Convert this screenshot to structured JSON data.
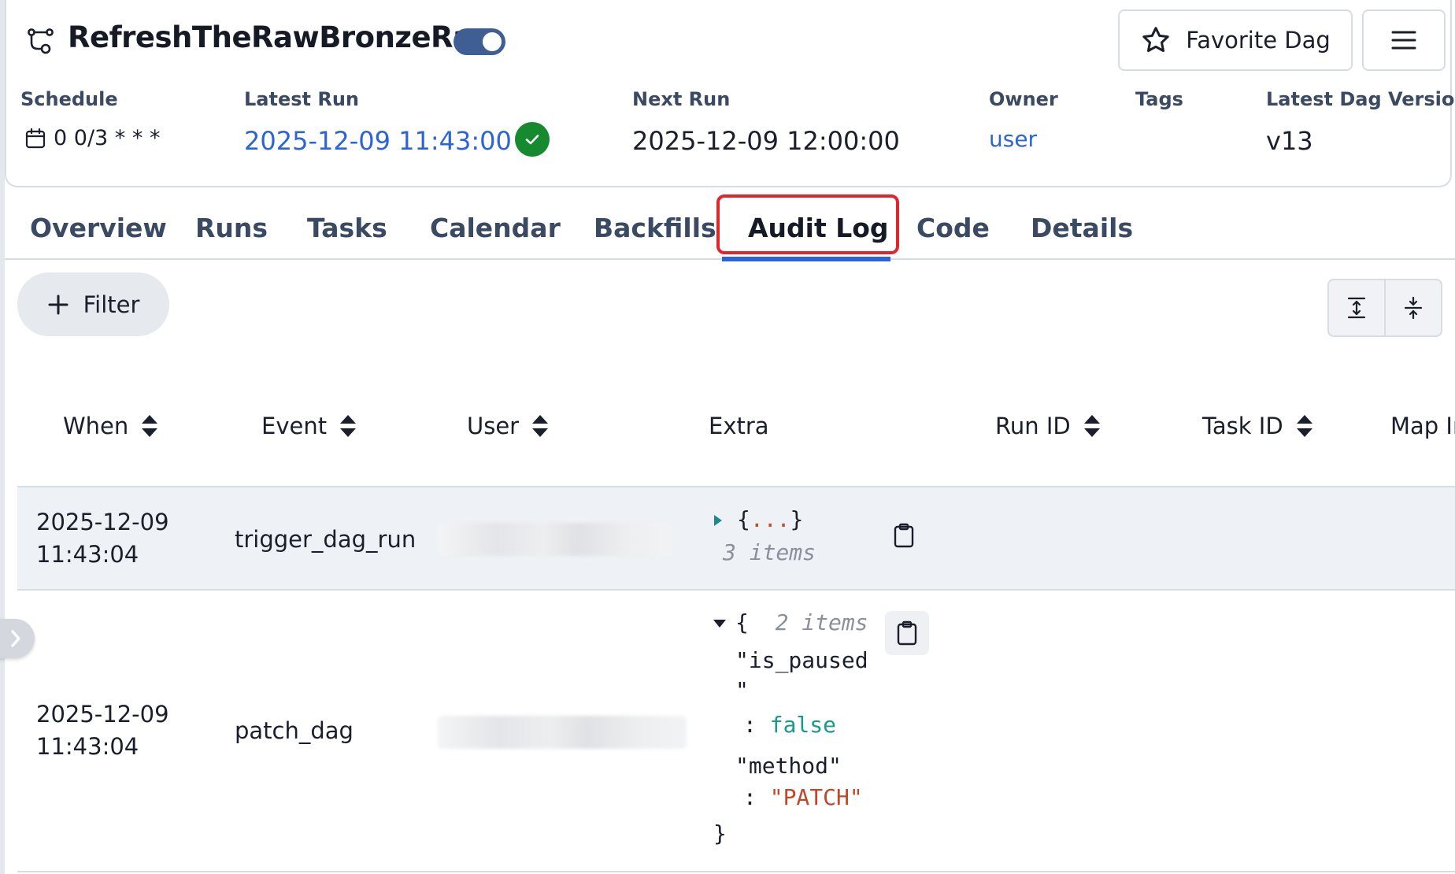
{
  "header": {
    "dag_title": "RefreshTheRawBronzeRaw",
    "toggle_state": "on",
    "favorite_label": "Favorite Dag"
  },
  "meta": {
    "schedule_label": "Schedule",
    "schedule_value": "0 0/3 * * *",
    "latest_run_label": "Latest Run",
    "latest_run_value": "2025-12-09 11:43:00",
    "next_run_label": "Next Run",
    "next_run_value": "2025-12-09 12:00:00",
    "owner_label": "Owner",
    "owner_value": "user",
    "tags_label": "Tags",
    "version_label": "Latest Dag Version",
    "version_value": "v13"
  },
  "tabs": [
    {
      "label": "Overview"
    },
    {
      "label": "Runs"
    },
    {
      "label": "Tasks"
    },
    {
      "label": "Calendar"
    },
    {
      "label": "Backfills"
    },
    {
      "label": "Audit Log",
      "active": true
    },
    {
      "label": "Code"
    },
    {
      "label": "Details"
    }
  ],
  "toolbar": {
    "filter_label": "Filter"
  },
  "table": {
    "columns": [
      "When",
      "Event",
      "User",
      "Extra",
      "Run ID",
      "Task ID",
      "Map In"
    ],
    "rows": [
      {
        "when_date": "2025-12-09",
        "when_time": "11:43:04",
        "event": "trigger_dag_run",
        "extra": {
          "collapsed_open": "{",
          "collapsed_dots": "...",
          "collapsed_close": "}",
          "count_text": "3 items"
        }
      },
      {
        "when_date": "2025-12-09",
        "when_time": "11:43:04",
        "event": "patch_dag",
        "extra": {
          "open_brace": "{",
          "count_text": "2 items",
          "key1": "\"is_paused",
          "key1_end": "\"",
          "colon": ":",
          "val1": "false",
          "key2": "\"method\"",
          "val2": "\"PATCH\"",
          "close_brace": "}"
        }
      }
    ]
  },
  "colors": {
    "accent": "#2c64d8",
    "success": "#168a2e",
    "toggle": "#3f5e94",
    "highlight": "#e0262b"
  }
}
